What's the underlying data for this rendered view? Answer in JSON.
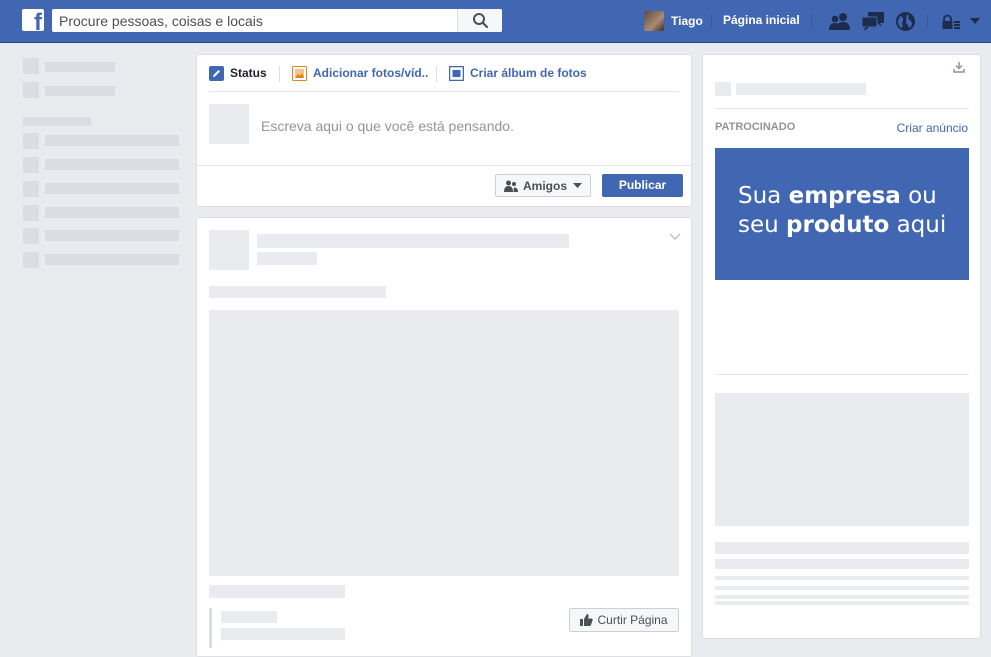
{
  "header": {
    "logo": "f",
    "search_placeholder": "Procure pessoas, coisas e locais",
    "user_name": "Tiago",
    "home_label": "Página inicial",
    "icons": [
      "friend-requests-icon",
      "messages-icon",
      "notifications-globe-icon",
      "privacy-lock-icon",
      "account-menu-caret-icon"
    ]
  },
  "composer": {
    "tabs": [
      "Status",
      "Adicionar fotos/víd..",
      "Criar álbum de fotos"
    ],
    "placeholder": "Escreva aqui o que você está pensando.",
    "audience_label": "Amigos",
    "publish_label": "Publicar"
  },
  "post": {
    "like_page_label": "Curtir Página"
  },
  "sidebar": {
    "sponsored_label": "PATROCINADO",
    "create_ad_label": "Criar anúncio",
    "ad_line1_a": "Sua ",
    "ad_line1_b": "empresa",
    "ad_line1_c": " ou",
    "ad_line2_a": "seu ",
    "ad_line2_b": "produto",
    "ad_line2_c": " aqui"
  },
  "colors": {
    "brand_blue": "#4267b2",
    "page_background": "#e9ebee",
    "placeholder_gray": "#dadde1"
  }
}
